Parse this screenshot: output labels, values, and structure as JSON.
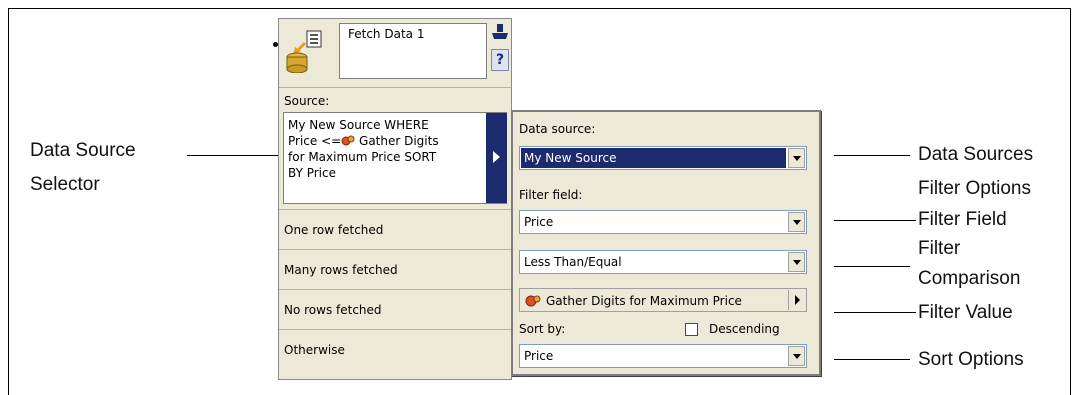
{
  "node": {
    "title": "Fetch Data 1",
    "help_label": "?",
    "source_label": "Source:",
    "source_text_1": "My New Source WHERE",
    "source_text_2a": "Price <=",
    "source_text_2b": " Gather Digits",
    "source_text_3": "for Maximum Price SORT",
    "source_text_4": "BY Price",
    "rows": [
      "One row fetched",
      "Many rows fetched",
      "No rows fetched",
      "Otherwise"
    ]
  },
  "panel": {
    "data_source_label": "Data source:",
    "data_source_value": "My New Source",
    "filter_field_label": "Filter field:",
    "filter_field_value": "Price",
    "comparison_value": "Less Than/Equal",
    "filter_value": "Gather Digits for Maximum Price",
    "sort_by_label": "Sort by:",
    "descending_label": "Descending",
    "descending_checked": false,
    "sort_value": "Price"
  },
  "callouts": {
    "data_source_selector_1": "Data Source",
    "data_source_selector_2": "Selector",
    "data_sources": "Data Sources",
    "filter_options": "Filter Options",
    "filter_field": "Filter Field",
    "filter_comparison_1": "Filter",
    "filter_comparison_2": "Comparison",
    "filter_value": "Filter Value",
    "sort_options": "Sort Options"
  },
  "colors": {
    "panel_bg": "#ece9d8",
    "selection": "#1c2b6e",
    "border": "#7f9db9"
  }
}
